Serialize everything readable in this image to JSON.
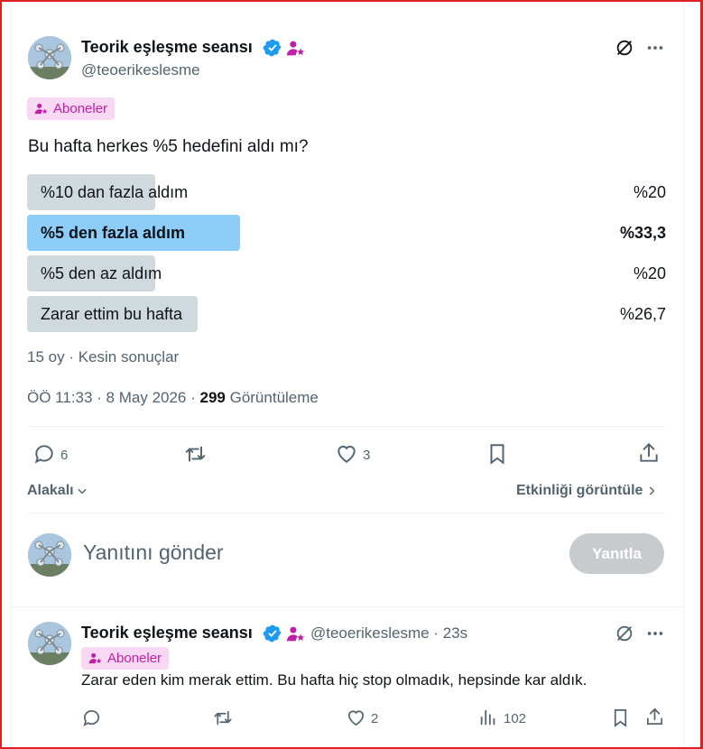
{
  "tweet": {
    "author_name": "Teorik eşleşme seansı",
    "author_handle": "@teoerikeslesme",
    "subscriber_badge": "Aboneler",
    "question": "Bu hafta herkes %5 hedefini aldı mı?",
    "poll": [
      {
        "label": "%10 dan fazla aldım",
        "percent_text": "%20",
        "percent": 20,
        "winner": false
      },
      {
        "label": "%5 den fazla aldım",
        "percent_text": "%33,3",
        "percent": 33.3,
        "winner": true
      },
      {
        "label": "%5 den az aldım",
        "percent_text": "%20",
        "percent": 20,
        "winner": false
      },
      {
        "label": "Zarar ettim bu hafta",
        "percent_text": "%26,7",
        "percent": 26.7,
        "winner": false
      }
    ],
    "poll_footer": "15 oy · Kesin sonuçlar",
    "timestamp": "ÖÖ 11:33 · 8 May 2026 · ",
    "views_count": "299",
    "views_label": " Görüntüleme",
    "actions": {
      "replies": "6",
      "likes": "3"
    },
    "relevance_label": "Alakalı",
    "activity_label": "Etkinliği görüntüle"
  },
  "reply_box": {
    "placeholder": "Yanıtını gönder",
    "button_label": "Yanıtla"
  },
  "reply": {
    "author_name": "Teorik eşleşme seansı",
    "author_handle": "@teoerikeslesme · 23s",
    "subscriber_badge": "Aboneler",
    "text": "Zarar eden kim merak ettim. Bu hafta hiç stop olmadık, hepsinde kar aldık.",
    "likes": "2",
    "views": "102"
  },
  "colors": {
    "verified": "#1d9bf0",
    "subscriber_badge_bg": "#f8d8f3",
    "subscriber_accent": "#c21fa8",
    "poll_winner": "#8ecdf8",
    "poll_default": "#cfd9de",
    "reply_button": "#c7cbcd"
  },
  "icons": [
    "verified-badge-icon",
    "subscriber-icon",
    "grok-icon",
    "more-icon",
    "reply-icon",
    "retweet-icon",
    "like-icon",
    "bookmark-icon",
    "share-icon",
    "views-icon",
    "chevron-down-icon",
    "chevron-right-icon"
  ]
}
